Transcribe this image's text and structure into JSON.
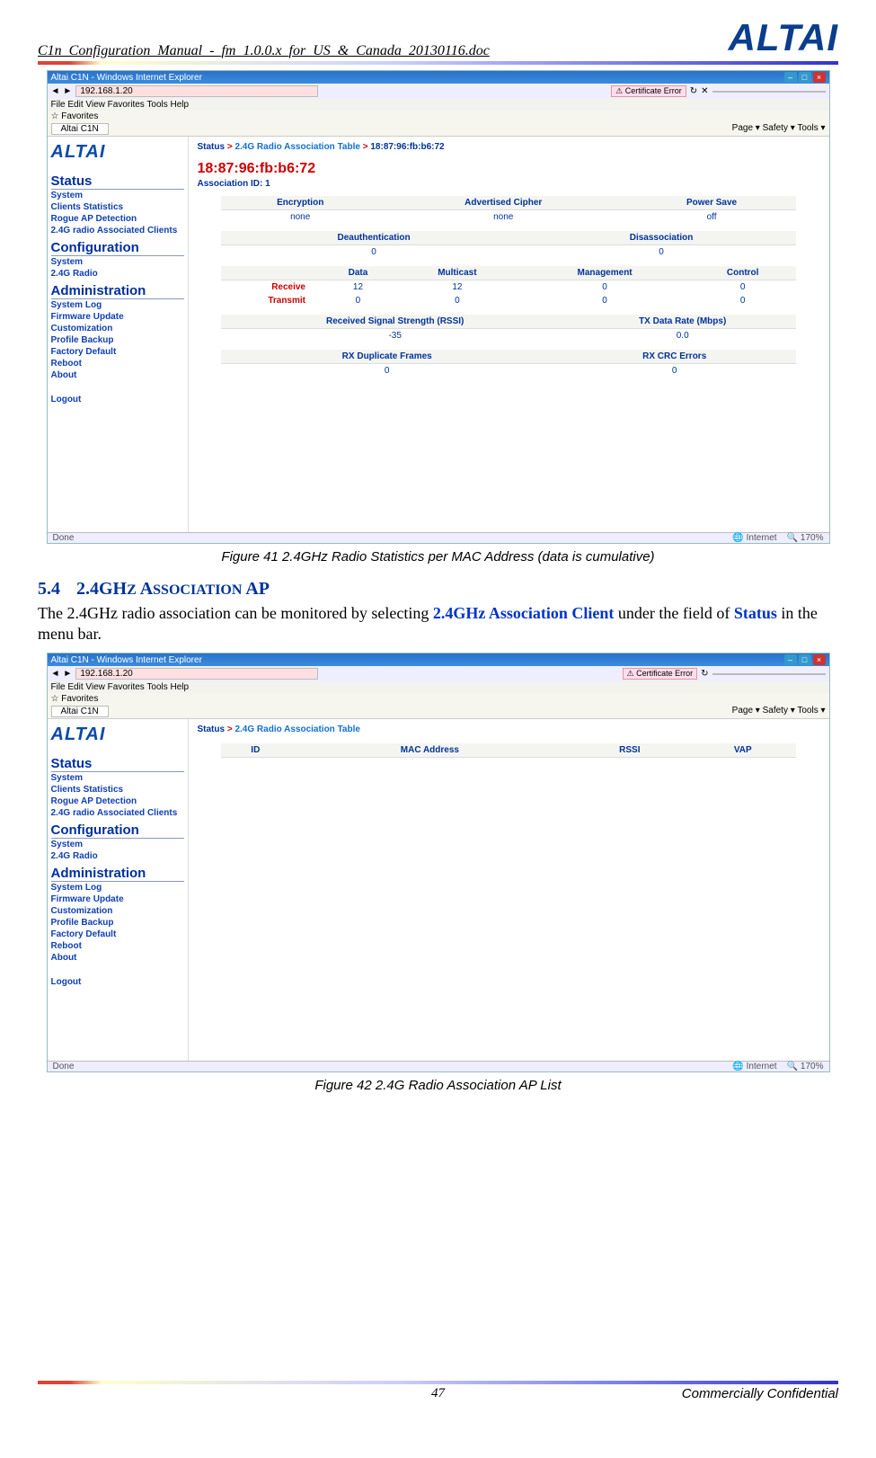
{
  "doc": {
    "filename": "C1n_Configuration_Manual_-_fm_1.0.0.x_for_US_&_Canada_20130116.doc",
    "logo": "ALTAI",
    "page_number": "47",
    "confidential": "Commercially Confidential"
  },
  "fig41": {
    "caption": "Figure 41    2.4GHz Radio Statistics per MAC Address (data is cumulative)",
    "window_title": "Altai C1N - Windows Internet Explorer",
    "address": "192.168.1.20",
    "cert_error": "Certificate Error",
    "menu": "File   Edit   View   Favorites   Tools   Help",
    "favorites": "Favorites",
    "tab": "Altai C1N",
    "toolbar_right": "Page ▾   Safety ▾   Tools ▾",
    "nav": {
      "status": "Status",
      "status_items": [
        "System",
        "Clients Statistics",
        "Rogue AP Detection",
        "2.4G radio Associated Clients"
      ],
      "config": "Configuration",
      "config_items": [
        "System",
        "2.4G Radio"
      ],
      "admin": "Administration",
      "admin_items": [
        "System Log",
        "Firmware Update",
        "Customization",
        "Profile Backup",
        "Factory Default",
        "Reboot",
        "About"
      ],
      "logout": "Logout"
    },
    "crumb": {
      "c1": "Status",
      "c2": "2.4G Radio Association Table",
      "c3": "18:87:96:fb:b6:72"
    },
    "mac": "18:87:96:fb:b6:72",
    "assoc": "Association ID: 1",
    "t1": {
      "h": [
        "Encryption",
        "Advertised Cipher",
        "Power Save"
      ],
      "r": [
        "none",
        "none",
        "off"
      ]
    },
    "t2": {
      "h": [
        "Deauthentication",
        "Disassociation"
      ],
      "r": [
        "0",
        "0"
      ]
    },
    "t3": {
      "h": [
        "",
        "Data",
        "Multicast",
        "Management",
        "Control"
      ],
      "r1": [
        "Receive",
        "12",
        "12",
        "0",
        "0"
      ],
      "r2": [
        "Transmit",
        "0",
        "0",
        "0",
        "0"
      ]
    },
    "t4": {
      "h": [
        "Received Signal Strength (RSSI)",
        "TX Data Rate (Mbps)"
      ],
      "r": [
        "-35",
        "0.0"
      ]
    },
    "t5": {
      "h": [
        "RX Duplicate Frames",
        "RX CRC Errors"
      ],
      "r": [
        "0",
        "0"
      ]
    },
    "status_done": "Done",
    "status_net": "Internet",
    "status_zoom": "170%"
  },
  "section": {
    "num": "5.4",
    "title_caps": "2.4GH",
    "title_sc1": "Z",
    "title_sc2": " A",
    "title_sc3": "SSOCIATION",
    "title_sc4": " AP",
    "body_pre": "The 2.4GHz radio association can be monitored by selecting ",
    "body_link1": "2.4GHz Association Client",
    "body_mid": " under the field of ",
    "body_link2": "Status",
    "body_post": " in the menu bar."
  },
  "fig42": {
    "caption": "Figure 42    2.4G Radio Association AP List",
    "crumb": {
      "c1": "Status",
      "c2": "2.4G Radio Association Table"
    },
    "th": [
      "ID",
      "MAC Address",
      "RSSI",
      "VAP"
    ]
  }
}
